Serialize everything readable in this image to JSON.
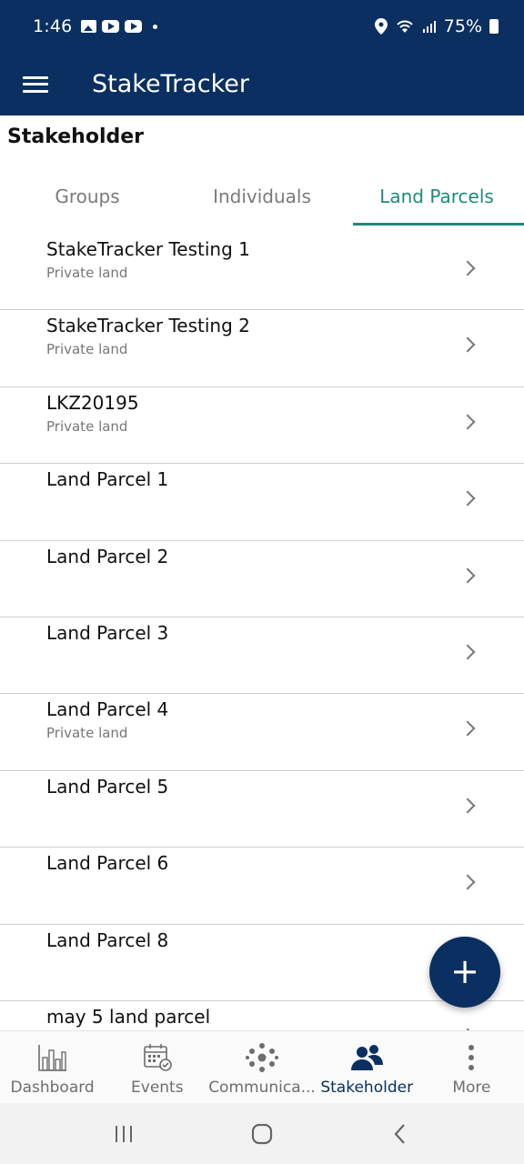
{
  "status_bar": {
    "time": "1:46",
    "battery": "75%"
  },
  "app_bar": {
    "title": "StakeTracker"
  },
  "page": {
    "title": "Stakeholder"
  },
  "tabs": [
    {
      "label": "Groups",
      "active": false
    },
    {
      "label": "Individuals",
      "active": false
    },
    {
      "label": "Land Parcels",
      "active": true
    }
  ],
  "parcels": [
    {
      "name": "StakeTracker Testing 1",
      "type": "Private land"
    },
    {
      "name": "StakeTracker Testing 2",
      "type": "Private land"
    },
    {
      "name": "LKZ20195",
      "type": "Private land"
    },
    {
      "name": "Land Parcel 1",
      "type": ""
    },
    {
      "name": "Land Parcel 2",
      "type": ""
    },
    {
      "name": "Land Parcel 3",
      "type": ""
    },
    {
      "name": "Land Parcel 4",
      "type": "Private land"
    },
    {
      "name": "Land Parcel 5",
      "type": ""
    },
    {
      "name": "Land Parcel 6",
      "type": ""
    },
    {
      "name": "Land Parcel 8",
      "type": ""
    },
    {
      "name": "may 5 land parcel",
      "type": ""
    }
  ],
  "fab": {
    "label": "+"
  },
  "bottom_nav": [
    {
      "label": "Dashboard",
      "icon": "bar-chart-icon",
      "active": false
    },
    {
      "label": "Events",
      "icon": "calendar-check-icon",
      "active": false
    },
    {
      "label": "Communica...",
      "icon": "network-dots-icon",
      "active": false
    },
    {
      "label": "Stakeholder",
      "icon": "people-icon",
      "active": true
    },
    {
      "label": "More",
      "icon": "more-vertical-icon",
      "active": false
    }
  ],
  "colors": {
    "primary": "#0b2f60",
    "accent": "#1f8a7a",
    "muted_text": "#777777"
  }
}
